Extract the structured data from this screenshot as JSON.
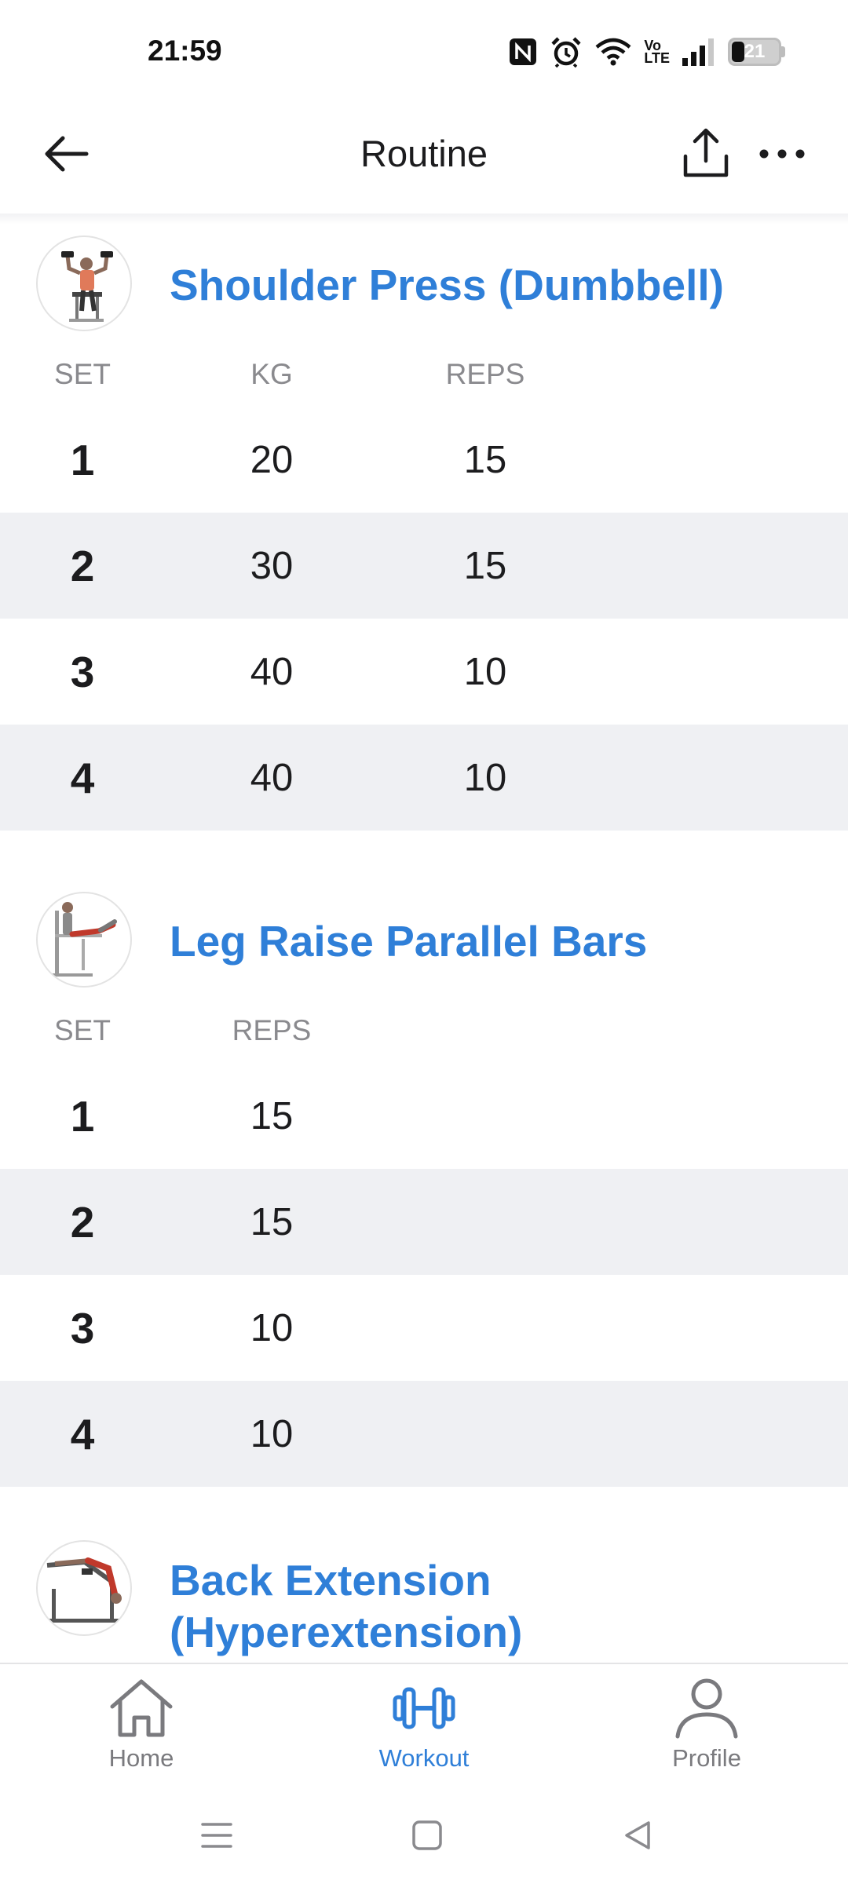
{
  "status_bar": {
    "time": "21:59",
    "battery_level": "21",
    "icons": [
      "nfc-icon",
      "alarm-icon",
      "wifi-icon",
      "volte-icon",
      "signal-icon",
      "battery-icon"
    ],
    "volte_top": "Vo",
    "volte_bottom": "LTE"
  },
  "app_bar": {
    "title": "Routine",
    "back_icon": "arrow-left-icon",
    "share_icon": "share-upload-icon",
    "more_icon": "more-horizontal-icon"
  },
  "exercises": [
    {
      "name": "Shoulder Press (Dumbbell)",
      "columns": [
        "SET",
        "KG",
        "REPS"
      ],
      "sets": [
        {
          "set": "1",
          "kg": "20",
          "reps": "15"
        },
        {
          "set": "2",
          "kg": "30",
          "reps": "15"
        },
        {
          "set": "3",
          "kg": "40",
          "reps": "10"
        },
        {
          "set": "4",
          "kg": "40",
          "reps": "10"
        }
      ]
    },
    {
      "name": "Leg Raise Parallel Bars",
      "columns": [
        "SET",
        "REPS"
      ],
      "sets": [
        {
          "set": "1",
          "reps": "15"
        },
        {
          "set": "2",
          "reps": "15"
        },
        {
          "set": "3",
          "reps": "10"
        },
        {
          "set": "4",
          "reps": "10"
        }
      ]
    },
    {
      "name": "Back Extension (Hyperextension)",
      "columns": [],
      "sets": []
    }
  ],
  "bottom_nav": {
    "items": [
      {
        "label": "Home",
        "icon": "home-icon",
        "active": false
      },
      {
        "label": "Workout",
        "icon": "dumbbell-icon",
        "active": true
      },
      {
        "label": "Profile",
        "icon": "profile-icon",
        "active": false
      }
    ]
  },
  "colors": {
    "accent": "#2f7fd8",
    "row_alt": "#eff0f3",
    "muted": "#8a8a8e"
  }
}
